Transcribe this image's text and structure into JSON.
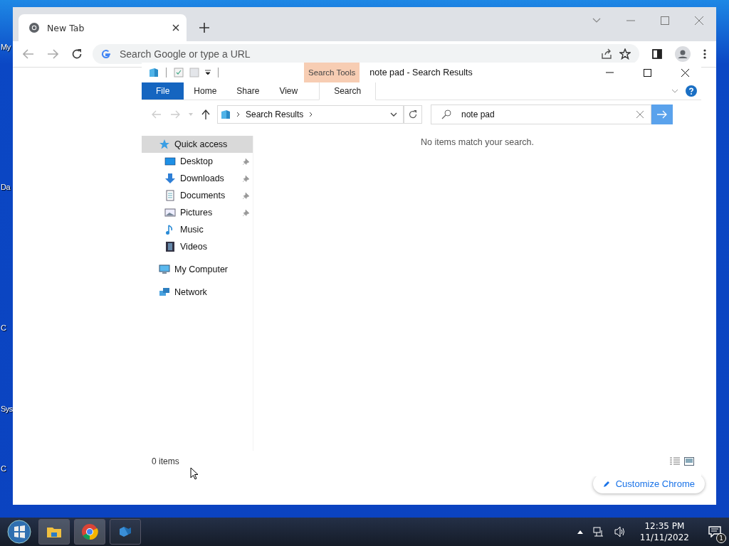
{
  "desktop": {
    "icon_labels": [
      "My",
      "Da",
      "C",
      "Sys",
      "C"
    ]
  },
  "browser": {
    "tabs": [
      {
        "title": "New Tab",
        "selected": true
      }
    ],
    "omnibox": {
      "placeholder": "Search Google or type a URL"
    },
    "customize_button": "Customize Chrome"
  },
  "explorer": {
    "title": "note pad - Search Results",
    "contextual_group": "Search Tools",
    "ribbon_tabs": [
      {
        "label": "File",
        "kind": "file",
        "selected": false
      },
      {
        "label": "Home",
        "kind": "plain",
        "selected": false
      },
      {
        "label": "Share",
        "kind": "plain",
        "selected": false
      },
      {
        "label": "View",
        "kind": "plain",
        "selected": false
      },
      {
        "label": "Search",
        "kind": "contextual",
        "selected": true
      }
    ],
    "breadcrumb": "Search Results",
    "search": {
      "value": "note pad"
    },
    "nav": [
      {
        "label": "Quick access",
        "kind": "star",
        "selected": true,
        "children": [
          {
            "label": "Desktop",
            "kind": "desktop",
            "pinned": true
          },
          {
            "label": "Downloads",
            "kind": "download",
            "pinned": true
          },
          {
            "label": "Documents",
            "kind": "document",
            "pinned": true
          },
          {
            "label": "Pictures",
            "kind": "picture",
            "pinned": true
          },
          {
            "label": "Music",
            "kind": "music",
            "pinned": false
          },
          {
            "label": "Videos",
            "kind": "video",
            "pinned": false
          }
        ]
      },
      {
        "label": "My Computer",
        "kind": "computer",
        "selected": false
      },
      {
        "label": "Network",
        "kind": "network",
        "selected": false
      }
    ],
    "message": "No items match your search.",
    "status": "0 items"
  },
  "taskbar": {
    "time": "12:35 PM",
    "date": "11/11/2022",
    "notification_count": "1"
  }
}
